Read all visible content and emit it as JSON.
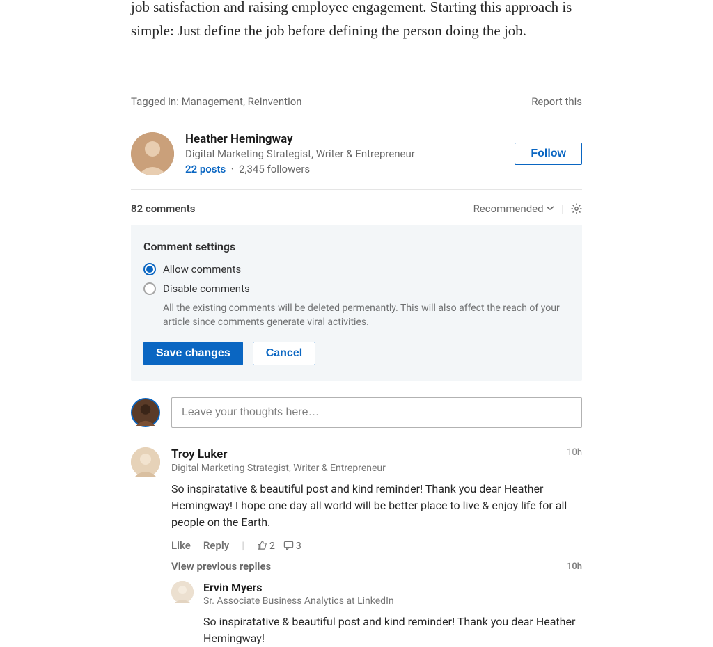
{
  "article": {
    "tail_text": "job satisfaction and raising employee engagement. Starting this approach is simple: Just define the job before defining the person doing the job."
  },
  "tags": {
    "label": "Tagged in:",
    "items": [
      "Management",
      "Reinvention"
    ],
    "report": "Report this"
  },
  "author": {
    "name": "Heather Hemingway",
    "headline": "Digital Marketing Strategist, Writer & Entrepreneur",
    "posts": "22 posts",
    "followers": "2,345 followers",
    "follow_label": "Follow"
  },
  "comments_header": {
    "count_label": "82 comments",
    "sort": "Recommended"
  },
  "settings": {
    "title": "Comment settings",
    "option_allow": "Allow comments",
    "option_disable": "Disable comments",
    "help": "All the existing comments will be deleted permenantly. This will also affect the reach of your article since comments generate viral activities.",
    "save": "Save changes",
    "cancel": "Cancel"
  },
  "compose": {
    "placeholder": "Leave your thoughts here…"
  },
  "comment1": {
    "name": "Troy Luker",
    "title": "Digital Marketing Strategist, Writer & Entrepreneur",
    "time": "10h",
    "text": "So inspiratative & beautiful post and kind reminder! Thank you dear Heather Hemingway! I hope one day all world will be better place to live & enjoy life for all people on the Earth.",
    "like": "Like",
    "reply": "Reply",
    "likes": "2",
    "replies": "3",
    "view_previous": "View previous replies",
    "vp_time": "10h"
  },
  "reply1": {
    "name": "Ervin Myers",
    "title": "Sr. Associate Business Analytics at LinkedIn",
    "text": "So inspiratative & beautiful post and kind reminder! Thank you dear Heather Hemingway!"
  }
}
